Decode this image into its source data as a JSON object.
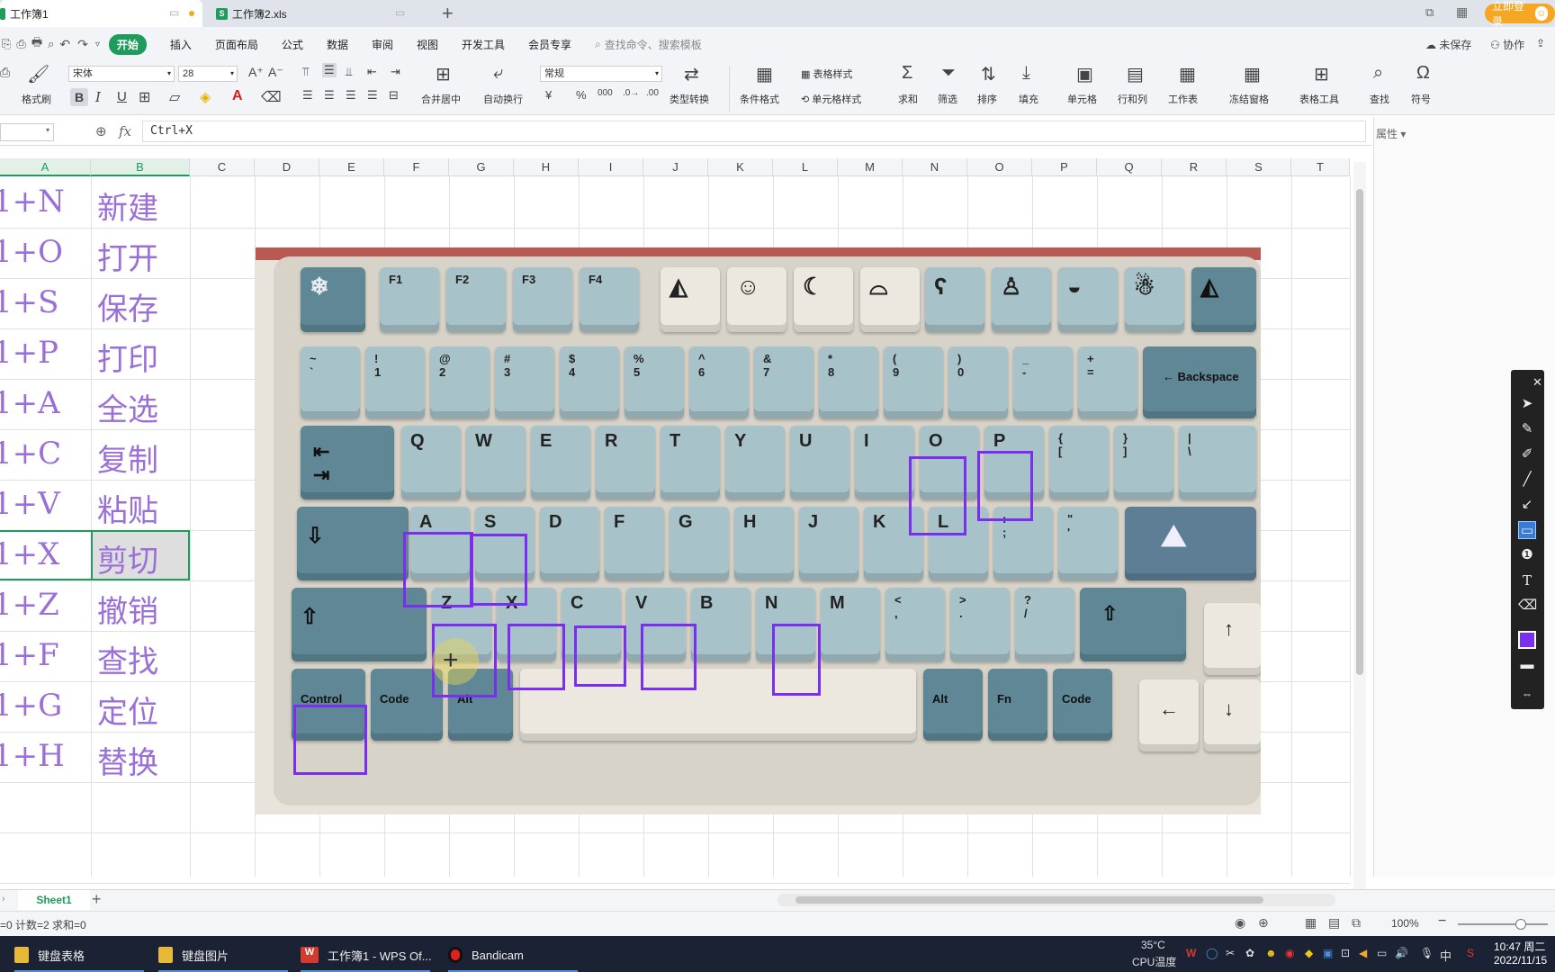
{
  "titlebar": {
    "tabs": [
      {
        "label": "工作簿1",
        "active": true
      },
      {
        "label": "工作簿2.xls",
        "active": false
      }
    ],
    "login_label": "立即登录"
  },
  "menubar": {
    "items": [
      "开始",
      "插入",
      "页面布局",
      "公式",
      "数据",
      "审阅",
      "视图",
      "开发工具",
      "会员专享"
    ],
    "search_placeholder": "查找命令、搜索模板",
    "unsaved": "未保存",
    "collab": "协作"
  },
  "ribbon": {
    "format_painter": "格式刷",
    "font_name": "宋体",
    "font_size": "28",
    "merge_center": "合并居中",
    "wrap_text": "自动换行",
    "number_format": "常规",
    "type_convert": "类型转换",
    "cond_format": "条件格式",
    "table_style": "表格样式",
    "cell_style": "单元格样式",
    "sum": "求和",
    "filter": "筛选",
    "sort": "排序",
    "fill": "填充",
    "cells": "单元格",
    "rows_cols": "行和列",
    "worksheet": "工作表",
    "freeze": "冻结窗格",
    "table_tools": "表格工具",
    "find": "查找",
    "symbol": "符号"
  },
  "formula_bar": {
    "fx": "fx",
    "value": "Ctrl+X"
  },
  "right_panel": {
    "title": "属性"
  },
  "columns": [
    "A",
    "B",
    "C",
    "D",
    "E",
    "F",
    "G",
    "H",
    "I",
    "J",
    "K",
    "L",
    "M",
    "N",
    "O",
    "P",
    "Q",
    "R",
    "S",
    "T"
  ],
  "rows": [
    {
      "a": "1+N",
      "b": "新建"
    },
    {
      "a": "1+O",
      "b": "打开"
    },
    {
      "a": "1+S",
      "b": "保存"
    },
    {
      "a": "1+P",
      "b": "打印"
    },
    {
      "a": "1+A",
      "b": "全选"
    },
    {
      "a": "1+C",
      "b": "复制"
    },
    {
      "a": "1+V",
      "b": "粘贴"
    },
    {
      "a": "1+X",
      "b": "剪切"
    },
    {
      "a": "1+Z",
      "b": "撤销"
    },
    {
      "a": "1+F",
      "b": "查找"
    },
    {
      "a": "1+G",
      "b": "定位"
    },
    {
      "a": "1+H",
      "b": "替换"
    }
  ],
  "keyboard": {
    "fn_keys": [
      "F1",
      "F2",
      "F3",
      "F4"
    ],
    "num_row": [
      [
        "~",
        "`"
      ],
      [
        "!",
        "1"
      ],
      [
        "@",
        "2"
      ],
      [
        "#",
        "3"
      ],
      [
        "$",
        "4"
      ],
      [
        "%",
        "5"
      ],
      [
        "^",
        "6"
      ],
      [
        "&",
        "7"
      ],
      [
        "*",
        "8"
      ],
      [
        "(",
        "9"
      ],
      [
        ")",
        "0"
      ],
      [
        "_",
        "-"
      ],
      [
        "+",
        "="
      ]
    ],
    "backspace": "← Backspace",
    "q_row": [
      "Q",
      "W",
      "E",
      "R",
      "T",
      "Y",
      "U",
      "I",
      "O",
      "P"
    ],
    "q_row_extra": [
      [
        "{",
        "["
      ],
      [
        "}",
        "]"
      ],
      [
        "|",
        "\\"
      ]
    ],
    "a_row": [
      "A",
      "S",
      "D",
      "F",
      "G",
      "H",
      "J",
      "K",
      "L"
    ],
    "a_row_extra": [
      [
        ":",
        ";"
      ],
      [
        "\"",
        "'"
      ]
    ],
    "z_row": [
      "Z",
      "X",
      "C",
      "V",
      "B",
      "N",
      "M"
    ],
    "z_row_extra": [
      [
        "<",
        ","
      ],
      [
        ">",
        "."
      ],
      [
        "?",
        "/"
      ]
    ],
    "bottom_left": [
      "Control",
      "Code",
      "Alt"
    ],
    "bottom_right": [
      "Alt",
      "Fn",
      "Code"
    ]
  },
  "sheet_tab": "Sheet1",
  "status": {
    "left": "=0  计数=2  求和=0",
    "zoom": "100%"
  },
  "taskbar": {
    "items": [
      "键盘表格",
      "键盘图片",
      "工作簿1 - WPS Of...",
      "Bandicam"
    ],
    "temp": "35°C",
    "temp_label": "CPU温度",
    "ime": "中",
    "time": "10:47 周二",
    "date": "2022/11/15"
  }
}
